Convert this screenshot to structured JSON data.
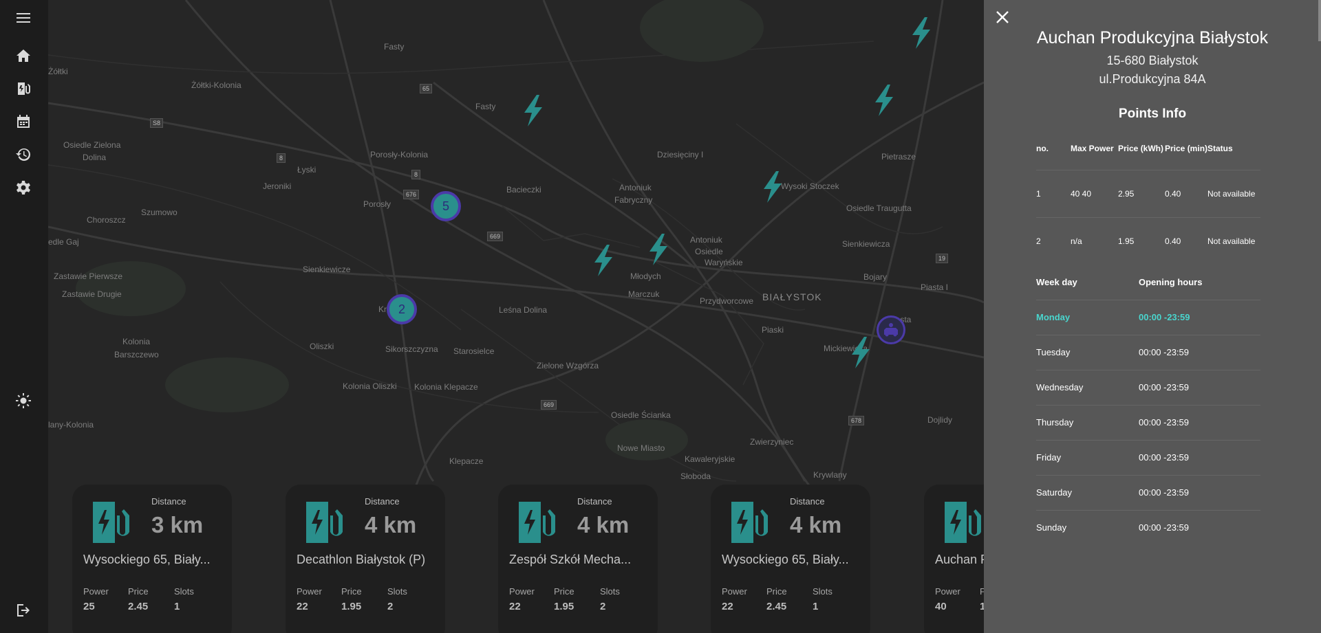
{
  "sidebar": {
    "items": [
      {
        "icon": "menu-icon"
      },
      {
        "icon": "home-icon"
      },
      {
        "icon": "charging-station-icon"
      },
      {
        "icon": "calendar-icon"
      },
      {
        "icon": "history-icon"
      },
      {
        "icon": "settings-icon"
      },
      {
        "icon": "light-mode-icon"
      },
      {
        "icon": "logout-icon"
      }
    ]
  },
  "map": {
    "places": [
      "Żółtki",
      "Żółtki-Kolonia",
      "Fasty",
      "Fasty",
      "Osiedle Zielona",
      "Dolina",
      "Porosły-Kolonia",
      "Łyski",
      "Jeroniki",
      "Porosły",
      "Choroszcz",
      "Szumowo",
      "edle Gaj",
      "Zastawie Pierwsze",
      "Zastawie Drugie",
      "Sienkiewicze",
      "Kolonia",
      "Barszczewo",
      "Oliszki",
      "Sikorszczyzna",
      "Kolonia Oliszki",
      "Kolonia Klepacze",
      "lany-Kolonia",
      "Klepacze",
      "Bacieczki",
      "Antoniuk",
      "Fabryczny",
      "Dziesięciny I",
      "Antoniuk",
      "Osiedle",
      "Waryńskie",
      "Młodych",
      "Marczuk",
      "Przydworcowe",
      "Leśna Dolina",
      "Starosielce",
      "Zielone Wzgórza",
      "Osiedle Ścianka",
      "Nowe Miasto",
      "Kawaleryjskie",
      "Słoboda",
      "Zwierzyniec",
      "Krywlany",
      "Piaski",
      "Mickiewicza",
      "Pietrasze",
      "Osiedle Traugutta",
      "Sienkiewicza",
      "Bojary",
      "Piasta I",
      "Piasta",
      "Dojlidy",
      "Wysoki Stoczek",
      "Kr"
    ],
    "city_label": "BIAŁYSTOK",
    "road_shields": [
      "S8",
      "8",
      "8",
      "65",
      "676",
      "669",
      "669",
      "19",
      "678"
    ],
    "clusters": [
      "5",
      "2"
    ],
    "colors": {
      "marker": "#2a8f8c",
      "cluster_border": "#4b3aa8",
      "background": "#262626"
    }
  },
  "cards": [
    {
      "distance_label": "Distance",
      "distance": "3 km",
      "name": "Wysockiego 65, Biały...",
      "power_label": "Power",
      "power": "25",
      "price_label": "Price",
      "price": "2.45",
      "slots_label": "Slots",
      "slots": "1"
    },
    {
      "distance_label": "Distance",
      "distance": "4 km",
      "name": "Decathlon Białystok (P)",
      "power_label": "Power",
      "power": "22",
      "price_label": "Price",
      "price": "1.95",
      "slots_label": "Slots",
      "slots": "2"
    },
    {
      "distance_label": "Distance",
      "distance": "4 km",
      "name": "Zespół Szkół Mecha...",
      "power_label": "Power",
      "power": "22",
      "price_label": "Price",
      "price": "1.95",
      "slots_label": "Slots",
      "slots": "2"
    },
    {
      "distance_label": "Distance",
      "distance": "4 km",
      "name": "Wysockiego 65, Biały...",
      "power_label": "Power",
      "power": "22",
      "price_label": "Price",
      "price": "2.45",
      "slots_label": "Slots",
      "slots": "1"
    },
    {
      "distance_label": "",
      "distance": "",
      "name": "Auchan P",
      "power_label": "Power",
      "power": "40",
      "price_label": "P",
      "price": "1",
      "slots_label": "",
      "slots": ""
    }
  ],
  "panel": {
    "title": "Auchan Produkcyjna Białystok",
    "postal_city": "15-680 Białystok",
    "street": "ul.Produkcyjna 84A",
    "points_heading": "Points Info",
    "points_headers": {
      "no": "no.",
      "max_power": "Max Power",
      "price_kwh": "Price (kWh)",
      "price_min": "Price (min)",
      "status": "Status"
    },
    "points": [
      {
        "no": "1",
        "max_power": "40 40",
        "price_kwh": "2.95",
        "price_min": "0.40",
        "status": "Not available"
      },
      {
        "no": "2",
        "max_power": "n/a",
        "price_kwh": "1.95",
        "price_min": "0.40",
        "status": "Not available"
      }
    ],
    "hours_headers": {
      "day": "Week day",
      "hours": "Opening hours"
    },
    "hours": [
      {
        "day": "Monday",
        "hours": "00:00 -23:59",
        "today": true
      },
      {
        "day": "Tuesday",
        "hours": "00:00 -23:59"
      },
      {
        "day": "Wednesday",
        "hours": "00:00 -23:59"
      },
      {
        "day": "Thursday",
        "hours": "00:00 -23:59"
      },
      {
        "day": "Friday",
        "hours": "00:00 -23:59"
      },
      {
        "day": "Saturday",
        "hours": "00:00 -23:59"
      },
      {
        "day": "Sunday",
        "hours": "00:00 -23:59"
      }
    ],
    "accent_color": "#49d6ce"
  }
}
